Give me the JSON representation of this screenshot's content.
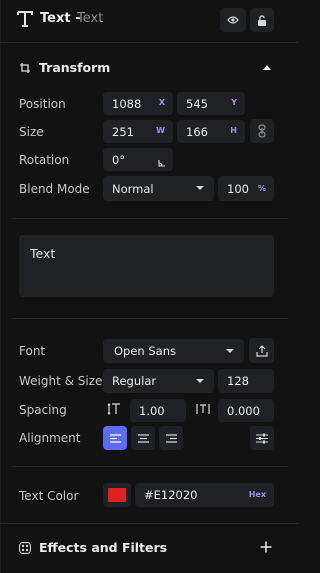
{
  "header": {
    "type_label": "Text -",
    "layer_name": "Text",
    "visibility_icon": "eye-icon",
    "lock_icon": "unlock-icon"
  },
  "transform": {
    "title": "Transform",
    "position": {
      "label": "Position",
      "x": "1088",
      "x_suffix": "X",
      "y": "545",
      "y_suffix": "Y"
    },
    "size": {
      "label": "Size",
      "w": "251",
      "w_suffix": "W",
      "h": "166",
      "h_suffix": "H"
    },
    "rotation": {
      "label": "Rotation",
      "value": "0°"
    },
    "blend": {
      "label": "Blend Mode",
      "mode": "Normal",
      "opacity": "100",
      "opacity_suffix": "%"
    }
  },
  "text_content": "Text",
  "typography": {
    "font": {
      "label": "Font",
      "value": "Open Sans"
    },
    "weight_size": {
      "label": "Weight & Size",
      "weight": "Regular",
      "size": "128"
    },
    "spacing": {
      "label": "Spacing",
      "line_height": "1.00",
      "letter_spacing": "0.000"
    },
    "alignment": {
      "label": "Alignment",
      "selected": "left"
    }
  },
  "text_color": {
    "label": "Text Color",
    "hex": "#E12020",
    "format": "Hex",
    "swatch": "#e12020"
  },
  "effects": {
    "title": "Effects and Filters"
  },
  "colors": {
    "accent": "#5b6cf0",
    "panel": "#121212",
    "field": "#202124"
  }
}
